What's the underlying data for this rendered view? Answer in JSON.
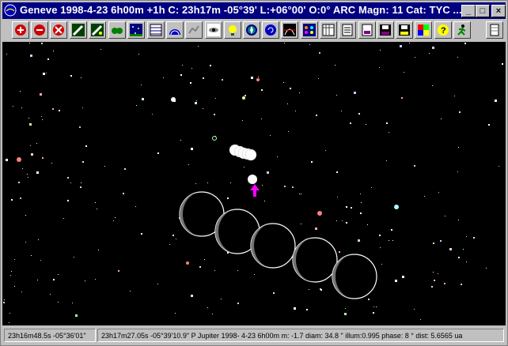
{
  "window": {
    "title": "Geneve 1998-4-23    6h00m +1h C: 23h17m -05°39' L:+06°00' O:0° ARC Magn: 11 Cat: TYC ...",
    "controls": [
      "_",
      "□",
      "×"
    ]
  },
  "toolbar": {
    "buttons": [
      {
        "name": "zoom-in-icon",
        "color": "#d00000"
      },
      {
        "name": "zoom-out-icon",
        "color": "#d00000"
      },
      {
        "name": "zoom-reset-icon",
        "color": "#d00000"
      },
      {
        "name": "telescope-icon",
        "color": "#004000"
      },
      {
        "name": "telescope-track-icon",
        "color": "#004000"
      },
      {
        "name": "binoculars-icon",
        "color": "#008000"
      },
      {
        "name": "star-field-icon",
        "color": "#000080"
      },
      {
        "name": "grid-icon",
        "color": "#000080"
      },
      {
        "name": "dome-icon",
        "color": "#0000c0"
      },
      {
        "name": "constellation-icon",
        "color": "#808080"
      },
      {
        "name": "galaxy-icon",
        "color": "#000000"
      },
      {
        "name": "lamp-icon",
        "color": "#c0c000"
      },
      {
        "name": "compass-icon",
        "color": "#008080"
      },
      {
        "name": "spiral-icon",
        "color": "#0000c0"
      },
      {
        "name": "meridian-icon",
        "color": "#0000c0"
      },
      {
        "name": "planets-icon",
        "color": "#000080"
      },
      {
        "name": "calendar-icon",
        "color": "#404040"
      },
      {
        "name": "document-icon",
        "color": "#000000"
      },
      {
        "name": "print-icon",
        "color": "#800080"
      },
      {
        "name": "save-disk-icon",
        "color": "#800080"
      },
      {
        "name": "save-as-icon",
        "color": "#800080"
      },
      {
        "name": "palette-icon",
        "color": "#808000"
      },
      {
        "name": "help-icon",
        "color": "#c0c000"
      },
      {
        "name": "run-icon",
        "color": "#008000"
      },
      {
        "name": "panel-icon",
        "color": "#808080"
      }
    ]
  },
  "sky": {
    "background": "#000000",
    "target_arrow_color": "#ff00ff",
    "object": "Jupiter",
    "jupiter_phase_disks": 5,
    "small_moon_disks": 5
  },
  "status": {
    "cursor_position": "23h16m48.5s -05°36'01\"",
    "object_info": "23h17m27.05s -05°39'10.9\"  P Jupiter  1998- 4-23   6h00m m: -1.7 diam: 34.8 \" illum:0.995 phase:   8 ° dist: 5.6565 ua"
  }
}
